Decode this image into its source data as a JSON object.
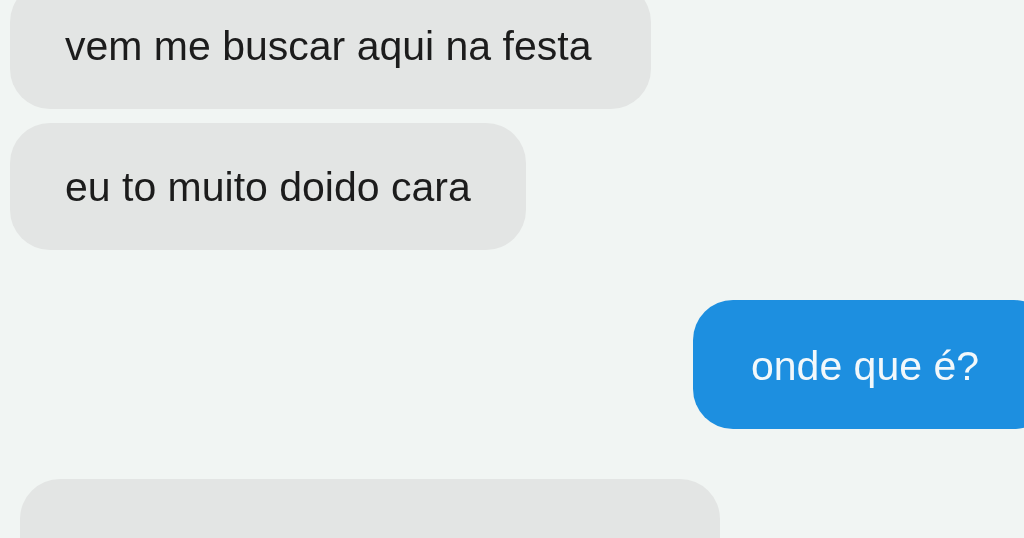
{
  "messages": [
    {
      "kind": "incoming",
      "text": "vem me buscar aqui na festa"
    },
    {
      "kind": "incoming",
      "text": "eu to muito doido cara"
    },
    {
      "kind": "outgoing",
      "text": "onde que é?"
    },
    {
      "kind": "incoming"
    }
  ]
}
